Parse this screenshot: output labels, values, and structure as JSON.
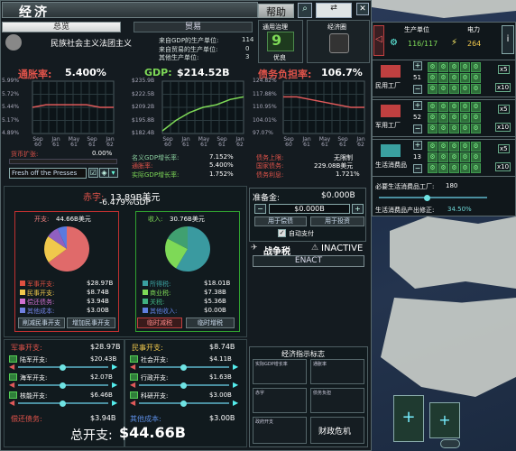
{
  "window": {
    "title": "经济",
    "help": "帮助",
    "close_icon": "✕"
  },
  "tabs": {
    "overview": "总览",
    "trade": "贸易"
  },
  "top_right": {
    "label1": "通用治理",
    "value1": "9",
    "sub1": "优良",
    "label2": "经济圈"
  },
  "ideology": {
    "name": "民族社会主义法团主义",
    "rows": [
      {
        "label": "来自GDP的生产单位:",
        "value": "114"
      },
      {
        "label": "来自贸易的生产单位:",
        "value": "0"
      },
      {
        "label": "其他生产单位:",
        "value": "3"
      }
    ]
  },
  "inflation": {
    "label": "通胀率:",
    "value": "5.400%",
    "ticks": [
      "5.99%",
      "5.72%",
      "5.44%",
      "5.17%",
      "4.89%"
    ],
    "x": [
      "Sep 60",
      "Jan 61",
      "May 61",
      "Sep 61",
      "Jan 62"
    ],
    "money_label": "货币扩张:",
    "money_value": "0.00%",
    "policy": "Fresh off the Presses"
  },
  "gdp": {
    "label": "GDP:",
    "value": "$214.52B",
    "ticks": [
      "$235.9B",
      "$222.5B",
      "$209.2B",
      "$195.8B",
      "$182.4B"
    ],
    "x": [
      "Sep 60",
      "Jan 61",
      "May 61",
      "Sep 61",
      "Jan 62"
    ],
    "rows": [
      {
        "label": "名义GDP增长率:",
        "value": "7.152%"
      },
      {
        "label": "通胀率:",
        "value": "5.400%"
      },
      {
        "label": "实际GDP增长率:",
        "value": "1.752%"
      }
    ]
  },
  "debt": {
    "label": "债务负担率:",
    "value": "106.7%",
    "ticks": [
      "124.82%",
      "117.88%",
      "110.95%",
      "104.01%",
      "97.07%"
    ],
    "x": [
      "Sep 60",
      "Jan 61",
      "May 61",
      "Sep 61",
      "Jan 62"
    ],
    "rows": [
      {
        "label": "债务上限:",
        "value": "无限制"
      },
      {
        "label": "国家债务:",
        "value": "229.08B美元"
      },
      {
        "label": "债务利息:",
        "value": "1.721%"
      }
    ]
  },
  "budget": {
    "deficit_label": "赤字:",
    "deficit": "13.89B美元",
    "deficit_pct": "-6.479%GDP",
    "exp_label": "开支:",
    "exp_total": "44.66B美元",
    "rev_label": "收入:",
    "rev_total": "30.76B美元",
    "exp_rows": [
      {
        "label": "军事开支:",
        "value": "$28.97B",
        "color": "#e05040"
      },
      {
        "label": "民事开支:",
        "value": "$8.74B",
        "color": "#f0c84c"
      },
      {
        "label": "偿还债务:",
        "value": "$3.94B",
        "color": "#d070d0"
      },
      {
        "label": "其他成本:",
        "value": "$3.00B",
        "color": "#7080e0"
      }
    ],
    "rev_rows": [
      {
        "label": "所得税:",
        "value": "$18.01B",
        "color": "#3aa0a0"
      },
      {
        "label": "商业税:",
        "value": "$7.38B",
        "color": "#7ed957"
      },
      {
        "label": "关税:",
        "value": "$5.36B",
        "color": "#40b080"
      },
      {
        "label": "其他收入:",
        "value": "$0.00B",
        "color": "#6080e0"
      }
    ],
    "cut_civil": "削减民事开支",
    "raise_civil": "增加民事开支",
    "temp_cut": "临时减税",
    "temp_raise": "临时增税"
  },
  "reserve": {
    "label": "准备金:",
    "value": "$0.000B",
    "input": "$0.000B",
    "repay": "用于偿债",
    "invest": "用于投资",
    "auto": "自动支付"
  },
  "war_tax": {
    "label": "战争税",
    "status": "INACTIVE",
    "enact": "ENACT"
  },
  "military": {
    "title": "军事开支:",
    "total": "$28.97B",
    "rows": [
      {
        "label": "陆军开支:",
        "value": "$20.43B"
      },
      {
        "label": "海军开支:",
        "value": "$2.07B"
      },
      {
        "label": "核能开支:",
        "value": "$6.46B"
      }
    ],
    "debt_label": "偿还债务:",
    "debt_value": "$3.94B"
  },
  "civil": {
    "title": "民事开支:",
    "total": "$8.74B",
    "rows": [
      {
        "label": "社会开支:",
        "value": "$4.11B"
      },
      {
        "label": "行政开支:",
        "value": "$1.63B"
      },
      {
        "label": "科研开支:",
        "value": "$3.00B"
      }
    ],
    "other_label": "其他成本:",
    "other_value": "$3.00B"
  },
  "grand_total": {
    "label": "总开支:",
    "value": "$44.66B"
  },
  "indicators": {
    "title": "经济指示标志",
    "items": [
      "实际GDP增长率",
      "通胀率",
      "债务负担率",
      "",
      "",
      "",
      "财政危机"
    ],
    "labels_small": [
      "实际GDP增长率",
      "通胀率",
      "赤字",
      "债务负担",
      "政府开支",
      "失业率"
    ],
    "crisis": "财政危机"
  },
  "right": {
    "units_label": "生产单位",
    "units_value": "116/117",
    "power_label": "电力",
    "power_value": "264",
    "civ_factory": "民用工厂",
    "civ_count": "51",
    "mil_factory": "军用工厂",
    "mil_count": "52",
    "goods": "生活消费品",
    "goods_count": "13",
    "need_label": "必要生活消费品工厂:",
    "need_value": "180",
    "mod_label": "生活消费品产出修正:",
    "mod_value": "34.50%",
    "x5": "x5",
    "x10": "x10"
  }
}
